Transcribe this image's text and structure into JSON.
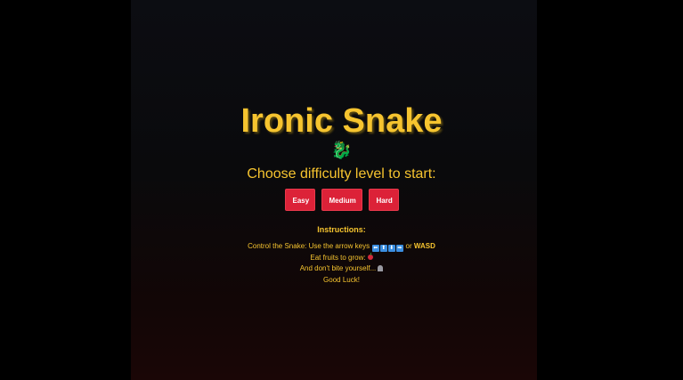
{
  "game": {
    "title": "Ironic Snake",
    "mascot_glyph": "🐉",
    "mascot_icon": "dragon-icon",
    "prompt": "Choose difficulty level to start:"
  },
  "difficulty": {
    "options": [
      "Easy",
      "Medium",
      "Hard"
    ]
  },
  "instructions": {
    "heading": "Instructions:",
    "line1_prefix": "Control the Snake: Use the arrow keys",
    "arrow_keys": [
      "⬅",
      "⬆",
      "⬇",
      "➡"
    ],
    "line1_or": "or",
    "line1_wasd": "WASD",
    "line2": "Eat fruits to grow:",
    "line2_icon": "apple-icon",
    "line3": "And don't bite yourself...",
    "line3_icon": "tombstone-icon",
    "line4": "Good Luck!"
  },
  "colors": {
    "accent": "#f6c42f",
    "button": "#dc2238",
    "keycap": "#3b8ee0"
  }
}
